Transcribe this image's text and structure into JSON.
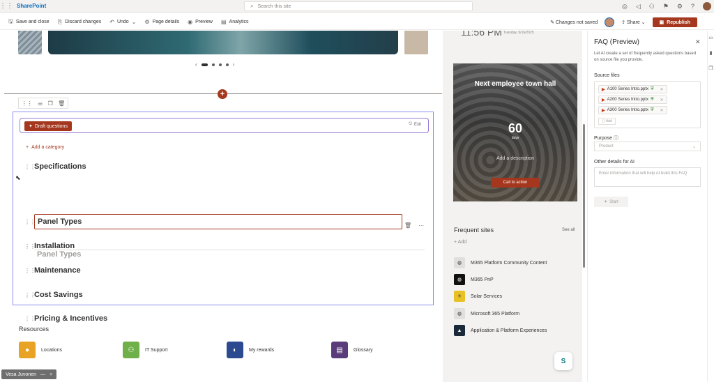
{
  "suite": {
    "app_name": "SharePoint",
    "search_placeholder": "Search this site"
  },
  "command_bar": {
    "save_close": "Save and close",
    "discard": "Discard changes",
    "undo": "Undo",
    "page_details": "Page details",
    "preview": "Preview",
    "analytics": "Analytics",
    "status": "Changes not saved",
    "share": "Share",
    "republish": "Republish"
  },
  "canvas": {
    "draft_button": "Draft questions",
    "exit": "Exit",
    "add_category": "Add a category",
    "categories": [
      "Specifications",
      "Panel Types",
      "Installation",
      "Maintenance",
      "Cost Savings",
      "Pricing & Incentives"
    ],
    "ghost_item": "Panel Types",
    "resources_title": "Resources",
    "resources": [
      "Locations",
      "IT Support",
      "My rewards",
      "Glossary"
    ],
    "user_pill": "Vesa Juvonen"
  },
  "rail": {
    "time": "11:56 PM",
    "date": "Tuesday, 9/16/2025",
    "townhall": {
      "title": "Next employee town hall",
      "count": "60",
      "unit": "days",
      "description": "Add a description",
      "cta": "Call to action"
    },
    "frequent_title": "Frequent sites",
    "see_all": "See all",
    "add": "Add",
    "sites": [
      "M365 Platform Community Content",
      "M365 PnP",
      "Solar Services",
      "Microsoft 365 Platform",
      "Application & Platform Experiences"
    ]
  },
  "faq": {
    "title": "FAQ (Preview)",
    "description": "Let AI create a set of frequently asked questions based on source file you provide.",
    "source_files_label": "Source files",
    "files": [
      "A100 Series Intro.pptx",
      "A200 Series Intro.pptx",
      "A300 Series Intro.pptx"
    ],
    "add": "Add",
    "purpose_label": "Purpose",
    "purpose_placeholder": "Product",
    "other_label": "Other details for AI",
    "other_placeholder": "Enter information that will help AI build this FAQ",
    "start": "Start"
  }
}
